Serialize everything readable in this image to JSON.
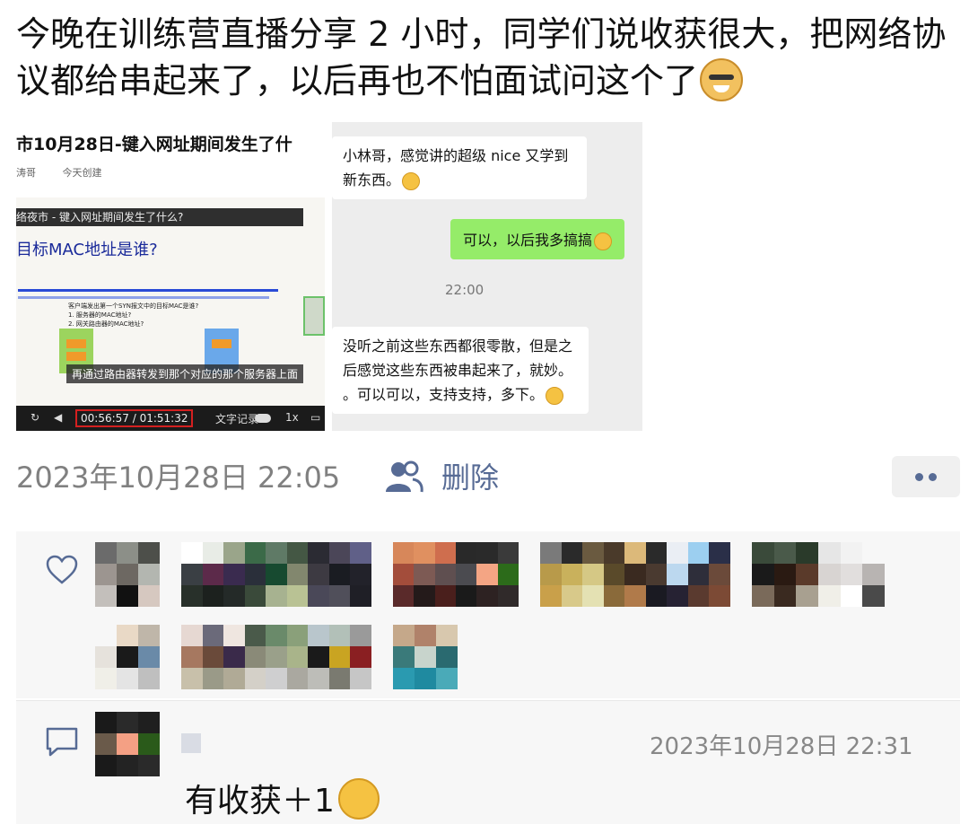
{
  "post": {
    "text": "今晚在训练营直播分享 2 小时，同学们说收获很大，把网络协议都给串起来了，以后再也不怕面试问这个了",
    "emoji": "doge-emoji"
  },
  "article": {
    "title": "市10月28日-键入网址期间发生了什",
    "author": "涛哥",
    "date": "今天创建",
    "video": {
      "top_bar": "络夜市 - 键入网址期间发生了什么?",
      "heading": "目标MAC地址是谁?",
      "question": "客户端发出第一个SYN报文中的目标MAC是谁?",
      "opt1": "1. 服务器的MAC地址?",
      "opt2": "2. 网关路由器的MAC地址?",
      "subtitle": "再通过路由器转发到那个对应的那个服务器上面",
      "time": "00:56:57 / 01:51:32",
      "caption_label": "文字记录",
      "speed": "1x"
    }
  },
  "chat": {
    "msg1": "小林哥，感觉讲的超级 nice 又学到新东西。",
    "reply": "可以，以后我多搞搞",
    "time": "22:00",
    "msg2": "没听之前这些东西都很零散，但是之后感觉这些东西被串起来了，就妙。 。可以可以，支持支持，多下。"
  },
  "meta": {
    "timestamp": "2023年10月28日 22:05",
    "delete_label": "删除"
  },
  "comment": {
    "time": "2023年10月28日 22:31",
    "text": "有收获＋1"
  },
  "colors": {
    "link": "#576b95",
    "chat_green": "#95ec69",
    "panel_bg": "#f7f7f7"
  }
}
